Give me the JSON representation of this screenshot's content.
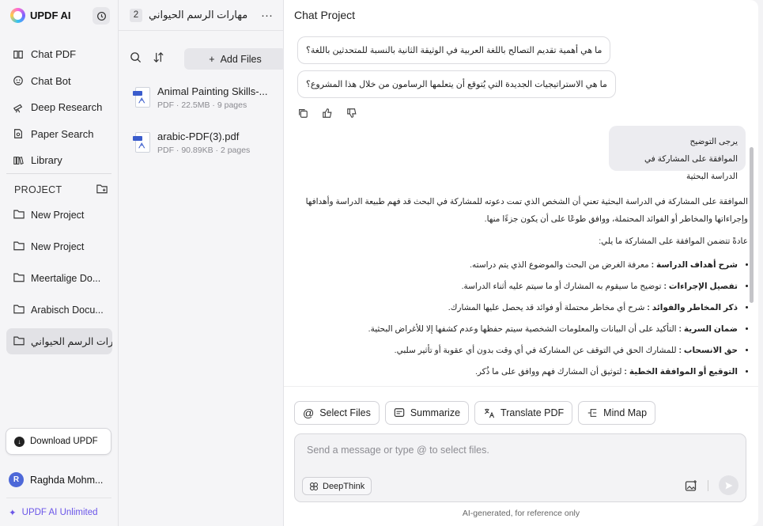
{
  "sidebar": {
    "brand": "UPDF AI",
    "nav": [
      {
        "label": "Chat PDF",
        "icon": "book-icon"
      },
      {
        "label": "Chat Bot",
        "icon": "bot-icon"
      },
      {
        "label": "Deep Research",
        "icon": "telescope-icon"
      },
      {
        "label": "Paper Search",
        "icon": "paper-search-icon"
      },
      {
        "label": "Library",
        "icon": "library-icon"
      }
    ],
    "project_label": "PROJECT",
    "projects": [
      {
        "label": "New Project"
      },
      {
        "label": "New Project"
      },
      {
        "label": "Meertalige Do..."
      },
      {
        "label": "Arabisch Docu..."
      },
      {
        "label": "مهارات الرسم الحيواني"
      }
    ],
    "download_label": "Download UPDF",
    "user_initial": "R",
    "user_name": "Raghda Mohm...",
    "unlimited_label": "UPDF AI Unlimited"
  },
  "files_panel": {
    "title": "مهارات الرسم الحيواني",
    "count": "2",
    "more": "···",
    "add_files_label": "Add Files",
    "files": [
      {
        "name": "Animal Painting Skills-...",
        "meta": "PDF · 22.5MB · 9 pages"
      },
      {
        "name": "arabic-PDF(3).pdf",
        "meta": "PDF · 90.89KB · 2 pages"
      }
    ]
  },
  "chat": {
    "title": "Chat Project",
    "suggestions": [
      "ما هي أهمية تقديم التصالح باللغة العربية في الوثيقة الثانية بالنسبة للمتحدثين باللغة؟",
      "ما هي الاستراتيجيات الجديدة التي يُتوقع أن يتعلمها الرسامون من خلال هذا المشروع؟"
    ],
    "user_message_line1": "يرجى التوضيح",
    "user_message_line2": "الموافقة على المشاركة في الدراسة البحثية",
    "answer_intro": "الموافقة على المشاركة في الدراسة البحثية تعني أن الشخص الذي تمت دعوته للمشاركة في البحث قد فهم طبيعة الدراسة وأهدافها وإجراءاتها والمخاطر أو الفوائد المحتملة، ووافق طوعًا على أن يكون جزءًا منها.",
    "answer_lead": "عادةً تتضمن الموافقة على المشاركة ما يلي:",
    "answer_points": [
      {
        "bold": "شرح أهداف الدراسة :",
        "text": " معرفة الغرض من البحث والموضوع الذي يتم دراسته."
      },
      {
        "bold": "تفصيل الإجراءات :",
        "text": " توضيح ما سيقوم به المشارك أو ما سيتم عليه أثناء الدراسة."
      },
      {
        "bold": "ذكر المخاطر والفوائد :",
        "text": " شرح أي مخاطر محتملة أو فوائد قد يحصل عليها المشارك."
      },
      {
        "bold": "ضمان السرية :",
        "text": " التأكيد على أن البيانات والمعلومات الشخصية سيتم حفظها وعدم كشفها إلا للأغراض البحثية."
      },
      {
        "bold": "حق الانسحاب :",
        "text": " للمشارك الحق في التوقف عن المشاركة في أي وقت بدون أي عقوبة أو تأثير سلبي."
      },
      {
        "bold": "التوقيع أو الموافقة الخطية :",
        "text": " لتوثيق أن المشارك فهم ووافق على ما ذُكر."
      }
    ],
    "tools": [
      {
        "label": "Select Files",
        "icon": "at-icon"
      },
      {
        "label": "Summarize",
        "icon": "summarize-icon"
      },
      {
        "label": "Translate PDF",
        "icon": "translate-icon"
      },
      {
        "label": "Mind Map",
        "icon": "mind-map-icon"
      }
    ],
    "input_placeholder": "Send a message or type @ to select files.",
    "deepthink_label": "DeepThink",
    "footnote": "AI-generated, for reference only"
  },
  "colors": {
    "accent": "#6a55e8",
    "avatar": "#4d68d8",
    "pdf_blue": "#3a5ccc"
  }
}
